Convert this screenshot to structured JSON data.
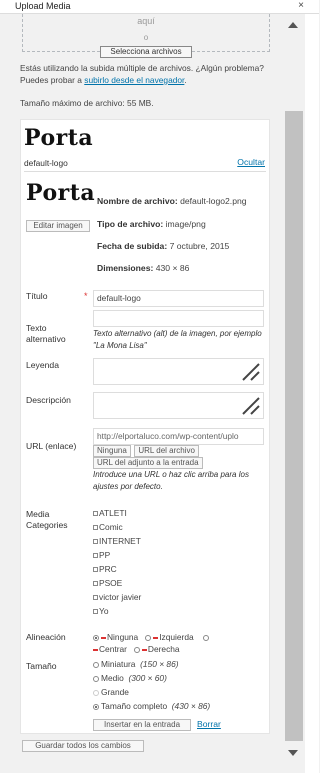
{
  "window": {
    "title": "Upload Media",
    "close_glyph": "×"
  },
  "drop_zone": {
    "drop_text": "aquí",
    "or_text": "o",
    "select_button": "Selecciona archivos"
  },
  "uploader_info": {
    "text_before": "Estás utilizando la subida múltiple de archivos. ¿Algún problema? Puedes probar a ",
    "link": "subirlo desde el navegador",
    "text_after": ".",
    "max_size": "Tamaño máximo de archivo: 55 MB."
  },
  "preview": {
    "logo_text": "Porta",
    "file_label": "default-logo",
    "hide_link": "Ocultar"
  },
  "details": {
    "edit_button": "Editar imagen",
    "filename_label": "Nombre de archivo:",
    "filename_value": "default-logo2.png",
    "filetype_label": "Tipo de archivo:",
    "filetype_value": "image/png",
    "upload_date_label": "Fecha de subida:",
    "upload_date_value": "7 octubre, 2015",
    "dimensions_label": "Dimensiones:",
    "dimensions_value": "430 × 86"
  },
  "form": {
    "title_label": "Título",
    "required_mark": "*",
    "title_value": "default-logo",
    "alt_label_1": "Texto",
    "alt_label_2": "alternativo",
    "alt_value": "",
    "alt_hint": "Texto alternativo (alt) de la imagen, por ejemplo \"La Mona Lisa\"",
    "caption_label": "Leyenda",
    "description_label": "Descripción",
    "url_label": "URL (enlace)",
    "url_value": "http://elportaluco.com/wp-content/uplo",
    "url_none": "Ninguna",
    "url_file": "URL del archivo",
    "url_attachment": "URL del adjunto a la entrada",
    "url_hint": "Introduce una URL o haz clic arriba para los ajustes por defecto.",
    "categories_label_1": "Media",
    "categories_label_2": "Categories",
    "categories": [
      "ATLETI",
      "Comic",
      "INTERNET",
      "PP",
      "PRC",
      "PSOE",
      "victor javier",
      "Yo"
    ],
    "alignment_label": "Alineación",
    "align_none": "Ninguna",
    "align_left": "Izquierda",
    "align_center": "Centrar",
    "align_right": "Derecha",
    "size_label": "Tamaño",
    "sizes": [
      {
        "name": "Miniatura",
        "dims": "(150 × 86)",
        "enabled": true
      },
      {
        "name": "Medio",
        "dims": "(300 × 60)",
        "enabled": true
      },
      {
        "name": "Grande",
        "dims": "",
        "enabled": false
      },
      {
        "name": "Tamaño completo",
        "dims": "(430 × 86)",
        "enabled": true
      }
    ],
    "insert_button": "Insertar en la entrada",
    "delete_link": "Borrar"
  },
  "footer": {
    "save_all_button": "Guardar todos los cambios"
  }
}
